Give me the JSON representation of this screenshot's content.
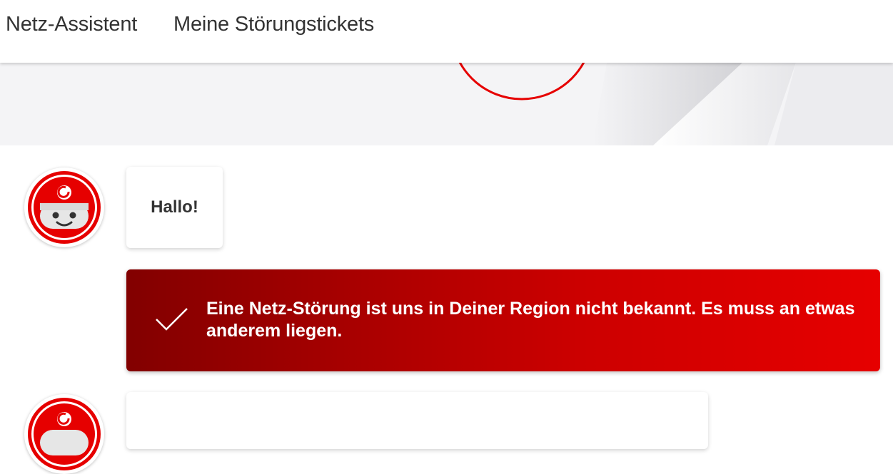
{
  "nav": {
    "items": [
      {
        "label": "Netz-Assistent"
      },
      {
        "label": "Meine Störungstickets"
      }
    ]
  },
  "chat": {
    "greeting": "Hallo!",
    "alert": {
      "icon": "checkmark-icon",
      "text": "Eine Netz-Störung ist uns in Deiner Region nicht bekannt. Es muss an etwas anderem liegen."
    }
  },
  "colors": {
    "brand_red": "#e60000",
    "dark_red": "#820000",
    "text": "#333333",
    "hero_bg": "#f4f4f6"
  },
  "icons": {
    "avatar": "vodafone-robot-avatar-icon",
    "hero_circle": "hero-ring-graphic"
  }
}
